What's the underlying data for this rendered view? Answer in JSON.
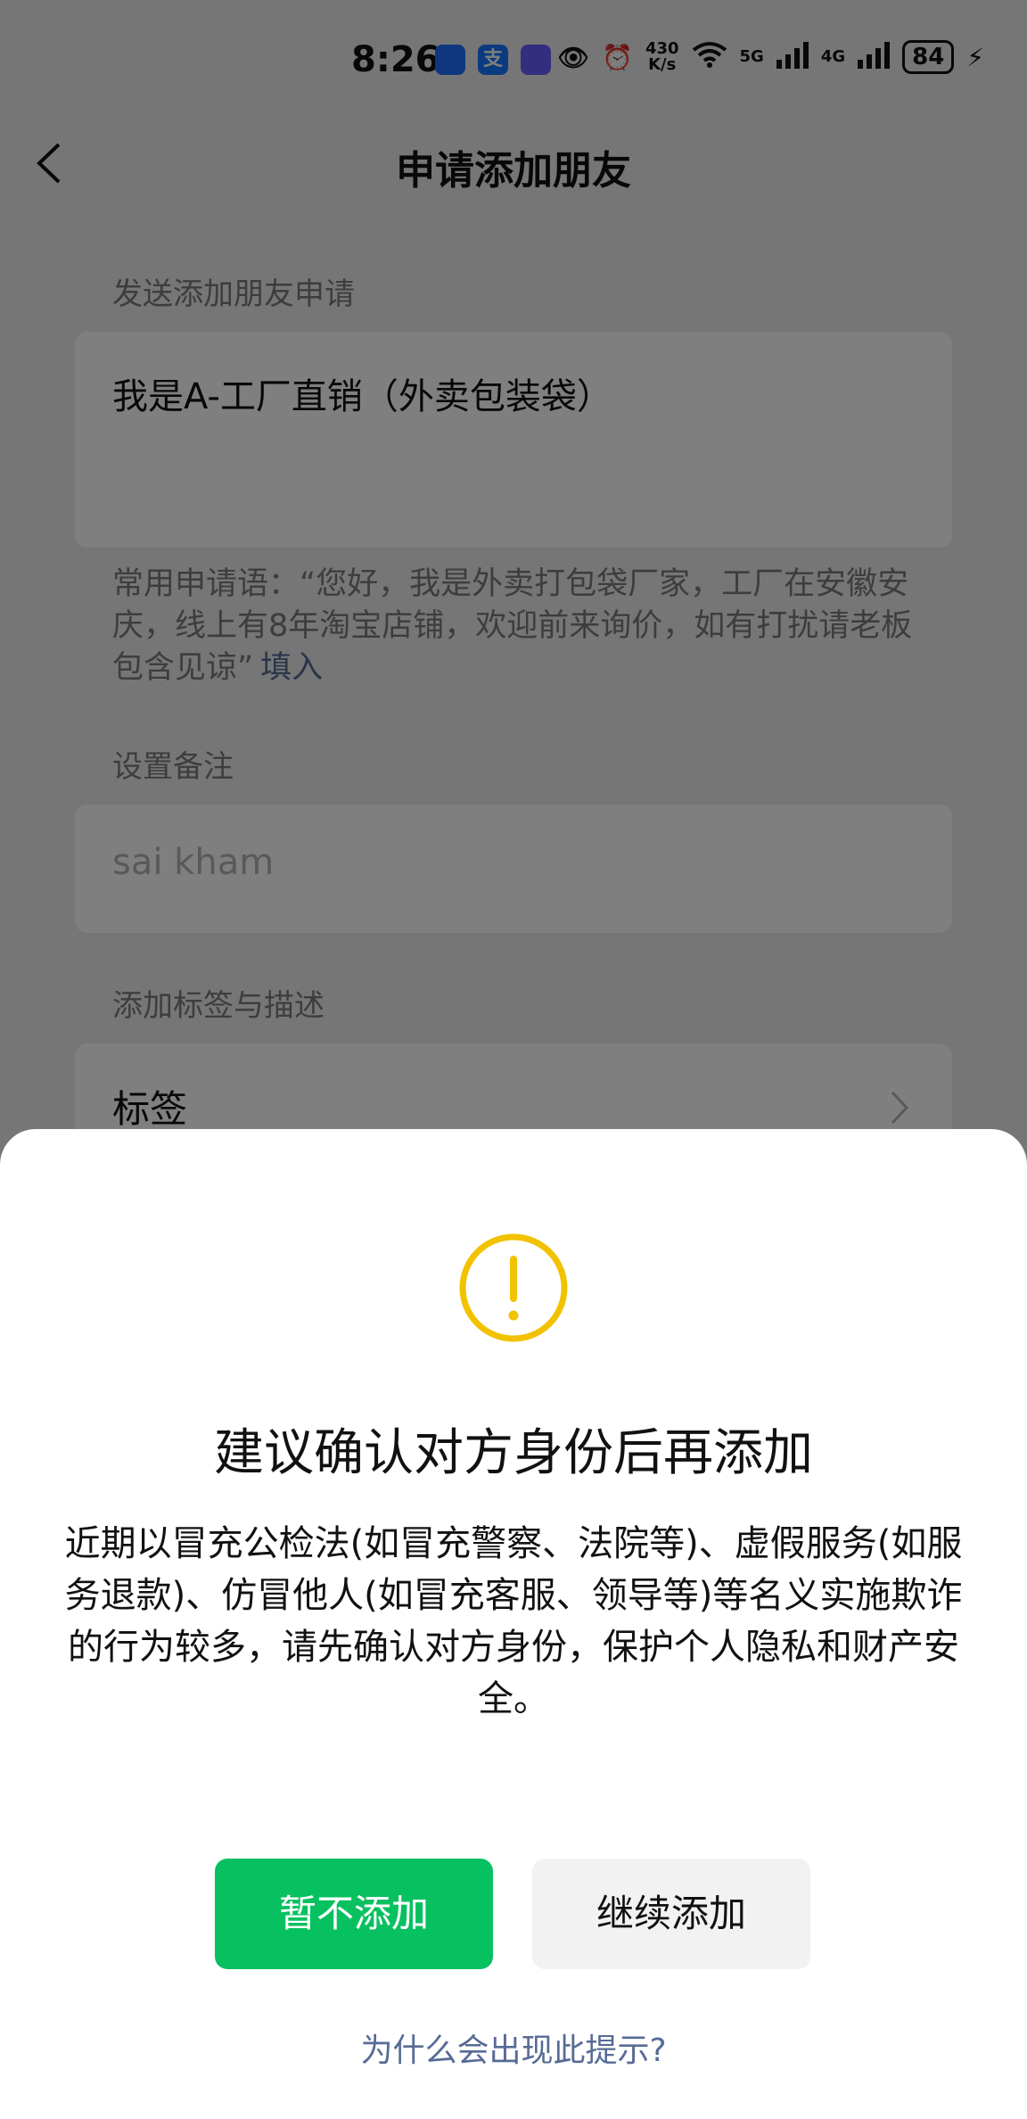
{
  "status_bar": {
    "time": "8:26",
    "net_speed_value": "430",
    "net_speed_unit": "K/s",
    "signal1": "5G",
    "signal2": "4G",
    "battery": "84"
  },
  "header": {
    "title": "申请添加朋友"
  },
  "request": {
    "section_label": "发送添加朋友申请",
    "message": "我是A-工厂直销（外卖包装袋）",
    "hint_text": "常用申请语：“您好，我是外卖打包袋厂家，工厂在安徽安庆，线上有8年淘宝店铺，欢迎前来询价，如有打扰请老板包含见谅”",
    "fill_link": "填入"
  },
  "remark": {
    "section_label": "设置备注",
    "value": "sai kham"
  },
  "tags": {
    "section_label": "添加标签与描述",
    "label": "标签"
  },
  "dialog": {
    "title": "建议确认对方身份后再添加",
    "body": "近期以冒充公检法(如冒充警察、法院等)、虚假服务(如服务退款)、仿冒他人(如冒充客服、领导等)等名义实施欺诈的行为较多，请先确认对方身份，保护个人隐私和财产安全。",
    "cancel_button": "暂不添加",
    "continue_button": "继续添加",
    "why_link": "为什么会出现此提示?"
  },
  "colors": {
    "primary_green": "#07c160",
    "link_blue": "#576b95",
    "warning_yellow": "#f2c200"
  },
  "icons": {
    "back": "chevron-left-icon",
    "chevron": "chevron-right-icon",
    "warning": "exclamation-circle-icon"
  }
}
